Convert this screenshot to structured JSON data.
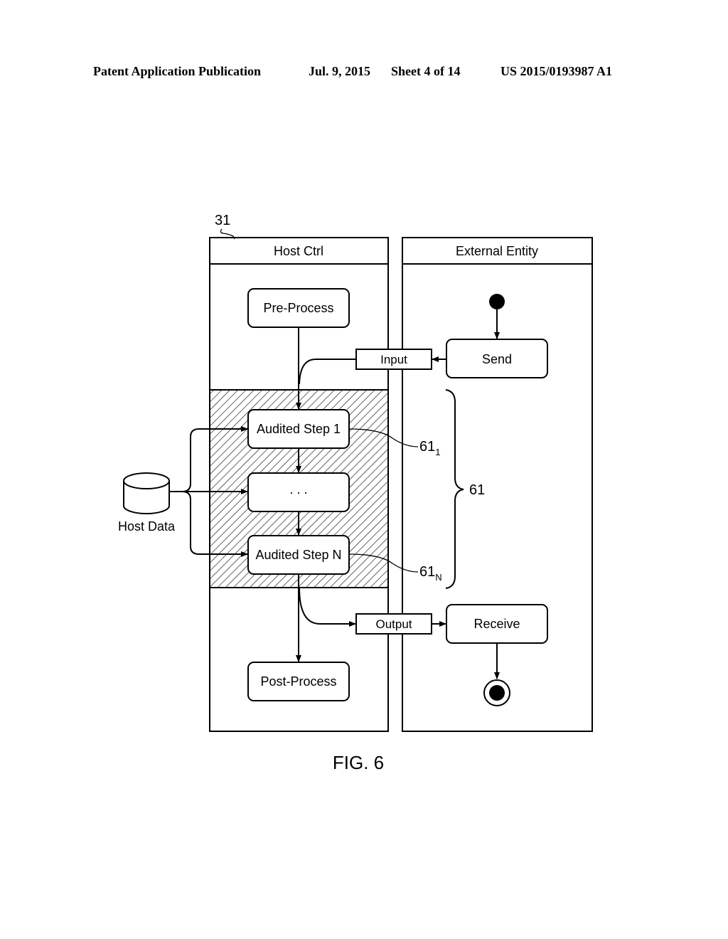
{
  "header": {
    "publication": "Patent Application Publication",
    "date": "Jul. 9, 2015",
    "sheet": "Sheet 4 of 14",
    "patent_number": "US 2015/0193987 A1"
  },
  "figure": {
    "caption": "FIG. 6",
    "reference_label": "31",
    "lanes": {
      "host": "Host Ctrl",
      "external": "External Entity"
    },
    "host_nodes": {
      "pre_process": "Pre-Process",
      "audited_step_1": "Audited Step 1",
      "ellipsis": ". . .",
      "audited_step_n": "Audited Step N",
      "post_process": "Post-Process"
    },
    "external_nodes": {
      "send": "Send",
      "receive": "Receive"
    },
    "pins": {
      "input": "Input",
      "output": "Output"
    },
    "data_store": "Host Data",
    "callouts": {
      "step1_base": "61",
      "step1_sub": "1",
      "stepn_base": "61",
      "stepn_sub": "N",
      "group": "61"
    }
  }
}
